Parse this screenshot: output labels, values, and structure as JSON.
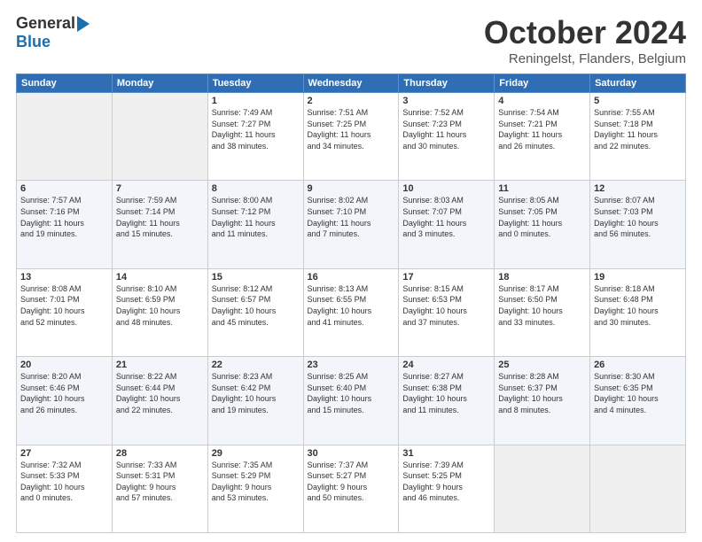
{
  "logo": {
    "general": "General",
    "blue": "Blue"
  },
  "title": "October 2024",
  "location": "Reningelst, Flanders, Belgium",
  "days_header": [
    "Sunday",
    "Monday",
    "Tuesday",
    "Wednesday",
    "Thursday",
    "Friday",
    "Saturday"
  ],
  "weeks": [
    [
      {
        "day": "",
        "info": ""
      },
      {
        "day": "",
        "info": ""
      },
      {
        "day": "1",
        "info": "Sunrise: 7:49 AM\nSunset: 7:27 PM\nDaylight: 11 hours\nand 38 minutes."
      },
      {
        "day": "2",
        "info": "Sunrise: 7:51 AM\nSunset: 7:25 PM\nDaylight: 11 hours\nand 34 minutes."
      },
      {
        "day": "3",
        "info": "Sunrise: 7:52 AM\nSunset: 7:23 PM\nDaylight: 11 hours\nand 30 minutes."
      },
      {
        "day": "4",
        "info": "Sunrise: 7:54 AM\nSunset: 7:21 PM\nDaylight: 11 hours\nand 26 minutes."
      },
      {
        "day": "5",
        "info": "Sunrise: 7:55 AM\nSunset: 7:18 PM\nDaylight: 11 hours\nand 22 minutes."
      }
    ],
    [
      {
        "day": "6",
        "info": "Sunrise: 7:57 AM\nSunset: 7:16 PM\nDaylight: 11 hours\nand 19 minutes."
      },
      {
        "day": "7",
        "info": "Sunrise: 7:59 AM\nSunset: 7:14 PM\nDaylight: 11 hours\nand 15 minutes."
      },
      {
        "day": "8",
        "info": "Sunrise: 8:00 AM\nSunset: 7:12 PM\nDaylight: 11 hours\nand 11 minutes."
      },
      {
        "day": "9",
        "info": "Sunrise: 8:02 AM\nSunset: 7:10 PM\nDaylight: 11 hours\nand 7 minutes."
      },
      {
        "day": "10",
        "info": "Sunrise: 8:03 AM\nSunset: 7:07 PM\nDaylight: 11 hours\nand 3 minutes."
      },
      {
        "day": "11",
        "info": "Sunrise: 8:05 AM\nSunset: 7:05 PM\nDaylight: 11 hours\nand 0 minutes."
      },
      {
        "day": "12",
        "info": "Sunrise: 8:07 AM\nSunset: 7:03 PM\nDaylight: 10 hours\nand 56 minutes."
      }
    ],
    [
      {
        "day": "13",
        "info": "Sunrise: 8:08 AM\nSunset: 7:01 PM\nDaylight: 10 hours\nand 52 minutes."
      },
      {
        "day": "14",
        "info": "Sunrise: 8:10 AM\nSunset: 6:59 PM\nDaylight: 10 hours\nand 48 minutes."
      },
      {
        "day": "15",
        "info": "Sunrise: 8:12 AM\nSunset: 6:57 PM\nDaylight: 10 hours\nand 45 minutes."
      },
      {
        "day": "16",
        "info": "Sunrise: 8:13 AM\nSunset: 6:55 PM\nDaylight: 10 hours\nand 41 minutes."
      },
      {
        "day": "17",
        "info": "Sunrise: 8:15 AM\nSunset: 6:53 PM\nDaylight: 10 hours\nand 37 minutes."
      },
      {
        "day": "18",
        "info": "Sunrise: 8:17 AM\nSunset: 6:50 PM\nDaylight: 10 hours\nand 33 minutes."
      },
      {
        "day": "19",
        "info": "Sunrise: 8:18 AM\nSunset: 6:48 PM\nDaylight: 10 hours\nand 30 minutes."
      }
    ],
    [
      {
        "day": "20",
        "info": "Sunrise: 8:20 AM\nSunset: 6:46 PM\nDaylight: 10 hours\nand 26 minutes."
      },
      {
        "day": "21",
        "info": "Sunrise: 8:22 AM\nSunset: 6:44 PM\nDaylight: 10 hours\nand 22 minutes."
      },
      {
        "day": "22",
        "info": "Sunrise: 8:23 AM\nSunset: 6:42 PM\nDaylight: 10 hours\nand 19 minutes."
      },
      {
        "day": "23",
        "info": "Sunrise: 8:25 AM\nSunset: 6:40 PM\nDaylight: 10 hours\nand 15 minutes."
      },
      {
        "day": "24",
        "info": "Sunrise: 8:27 AM\nSunset: 6:38 PM\nDaylight: 10 hours\nand 11 minutes."
      },
      {
        "day": "25",
        "info": "Sunrise: 8:28 AM\nSunset: 6:37 PM\nDaylight: 10 hours\nand 8 minutes."
      },
      {
        "day": "26",
        "info": "Sunrise: 8:30 AM\nSunset: 6:35 PM\nDaylight: 10 hours\nand 4 minutes."
      }
    ],
    [
      {
        "day": "27",
        "info": "Sunrise: 7:32 AM\nSunset: 5:33 PM\nDaylight: 10 hours\nand 0 minutes."
      },
      {
        "day": "28",
        "info": "Sunrise: 7:33 AM\nSunset: 5:31 PM\nDaylight: 9 hours\nand 57 minutes."
      },
      {
        "day": "29",
        "info": "Sunrise: 7:35 AM\nSunset: 5:29 PM\nDaylight: 9 hours\nand 53 minutes."
      },
      {
        "day": "30",
        "info": "Sunrise: 7:37 AM\nSunset: 5:27 PM\nDaylight: 9 hours\nand 50 minutes."
      },
      {
        "day": "31",
        "info": "Sunrise: 7:39 AM\nSunset: 5:25 PM\nDaylight: 9 hours\nand 46 minutes."
      },
      {
        "day": "",
        "info": ""
      },
      {
        "day": "",
        "info": ""
      }
    ]
  ]
}
